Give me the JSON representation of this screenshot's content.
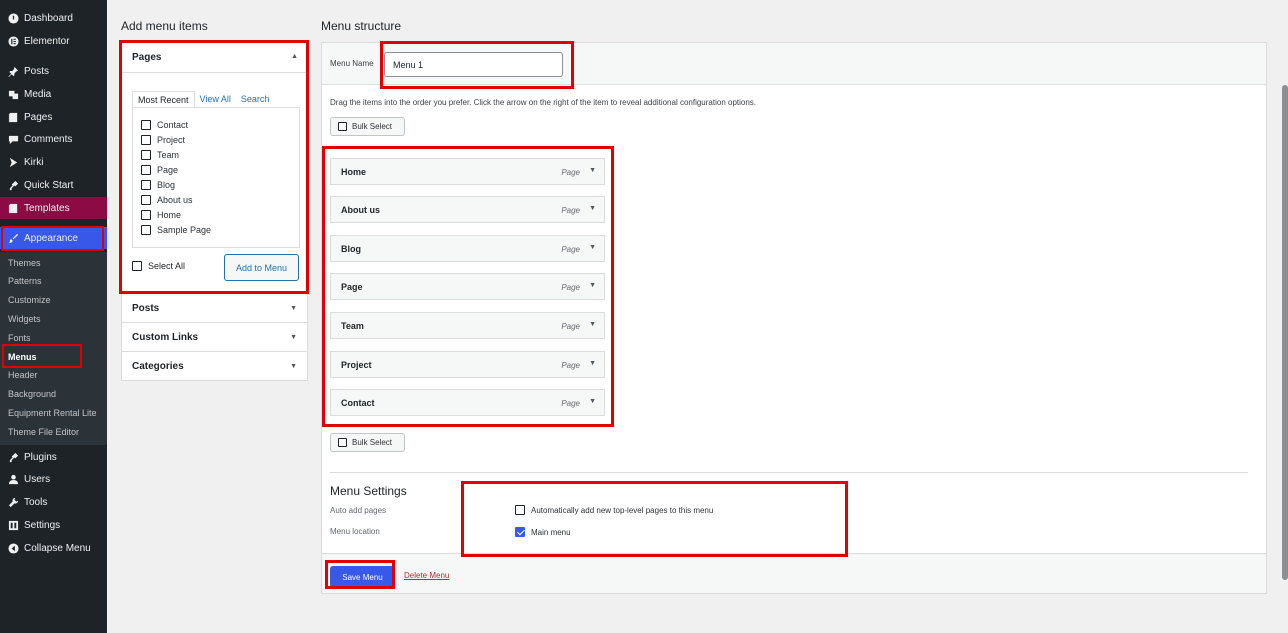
{
  "sidebar": {
    "items": [
      {
        "label": "Dashboard",
        "icon": "dashboard-icon"
      },
      {
        "label": "Elementor",
        "icon": "elementor-icon"
      },
      {
        "label": "Posts",
        "icon": "pin-icon"
      },
      {
        "label": "Media",
        "icon": "media-icon"
      },
      {
        "label": "Pages",
        "icon": "page-icon"
      },
      {
        "label": "Comments",
        "icon": "comment-icon"
      },
      {
        "label": "Kirki",
        "icon": "kirki-icon"
      },
      {
        "label": "Quick Start",
        "icon": "plugin-icon"
      },
      {
        "label": "Templates",
        "icon": "templates-icon"
      },
      {
        "label": "Appearance",
        "icon": "brush-icon"
      }
    ],
    "submenu": [
      "Themes",
      "Patterns",
      "Customize",
      "Widgets",
      "Fonts",
      "Menus",
      "Header",
      "Background",
      "Equipment Rental Lite",
      "Theme File Editor"
    ],
    "lower_items": [
      {
        "label": "Plugins",
        "icon": "plugin-icon"
      },
      {
        "label": "Users",
        "icon": "user-icon"
      },
      {
        "label": "Tools",
        "icon": "wrench-icon"
      },
      {
        "label": "Settings",
        "icon": "settings-icon"
      },
      {
        "label": "Collapse Menu",
        "icon": "collapse-icon"
      }
    ]
  },
  "add_items": {
    "title": "Add menu items",
    "pages": {
      "heading": "Pages",
      "tabs": [
        "Most Recent",
        "View All",
        "Search"
      ],
      "list": [
        "Contact",
        "Project",
        "Team",
        "Page",
        "Blog",
        "About us",
        "Home",
        "Sample Page"
      ],
      "select_all": "Select All",
      "add_button": "Add to Menu"
    },
    "accordions": [
      "Posts",
      "Custom Links",
      "Categories"
    ]
  },
  "structure": {
    "title": "Menu structure",
    "menu_name_label": "Menu Name",
    "menu_name_value": "Menu 1",
    "instructions": "Drag the items into the order you prefer. Click the arrow on the right of the item to reveal additional configuration options.",
    "bulk_select": "Bulk Select",
    "items": [
      {
        "label": "Home",
        "type": "Page"
      },
      {
        "label": "About us",
        "type": "Page"
      },
      {
        "label": "Blog",
        "type": "Page"
      },
      {
        "label": "Page",
        "type": "Page"
      },
      {
        "label": "Team",
        "type": "Page"
      },
      {
        "label": "Project",
        "type": "Page"
      },
      {
        "label": "Contact",
        "type": "Page"
      }
    ]
  },
  "settings": {
    "title": "Menu Settings",
    "auto_add_label": "Auto add pages",
    "auto_add_option": "Automatically add new top-level pages to this menu",
    "location_label": "Menu location",
    "location_option": "Main menu",
    "auto_add_checked": false,
    "main_menu_checked": true
  },
  "footer": {
    "save": "Save Menu",
    "delete": "Delete Menu"
  },
  "colors": {
    "sidebar_bg": "#1d2327",
    "accent": "#3858e9",
    "templates": "#8c0b45",
    "highlight_box": "#e00000"
  }
}
